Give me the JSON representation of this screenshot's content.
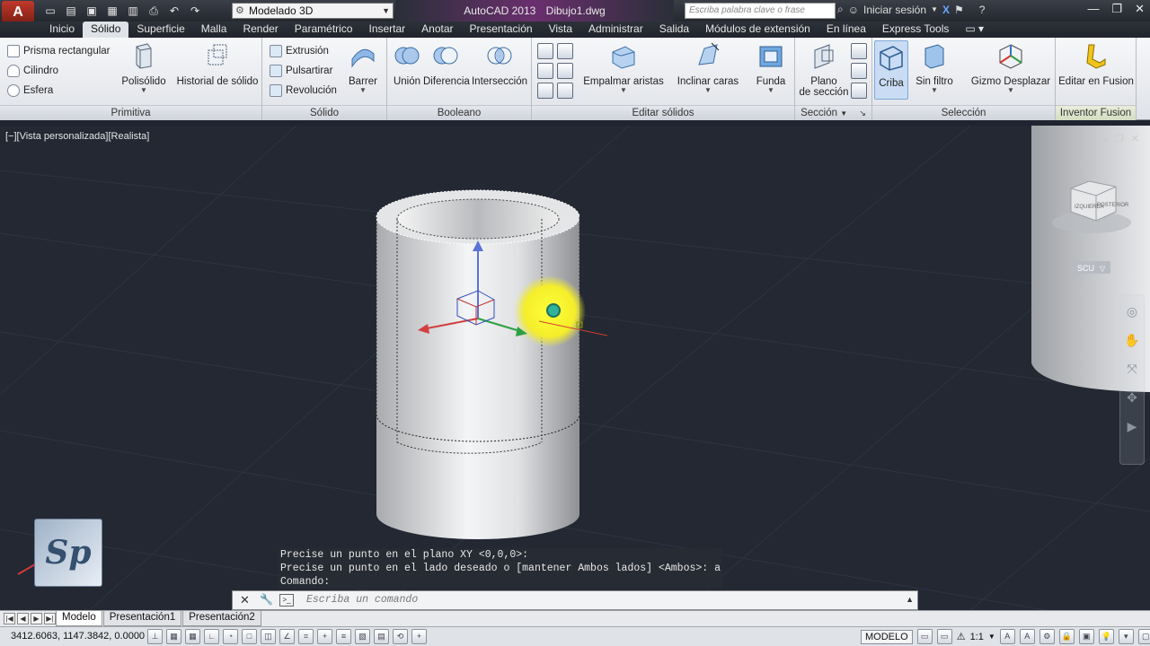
{
  "titlebar": {
    "app_button": "A",
    "workspace": "Modelado 3D",
    "app_name": "AutoCAD 2013",
    "document": "Dibujo1.dwg",
    "search_placeholder": "Escriba palabra clave o frase",
    "signin": "Iniciar sesión"
  },
  "tabs": [
    "Inicio",
    "Sólido",
    "Superficie",
    "Malla",
    "Render",
    "Paramétrico",
    "Insertar",
    "Anotar",
    "Presentación",
    "Vista",
    "Administrar",
    "Salida",
    "Módulos de extensión",
    "En línea",
    "Express Tools"
  ],
  "active_tab": "Sólido",
  "ribbon": {
    "primitiva": {
      "title": "Primitiva",
      "small": [
        "Prisma rectangular",
        "Cilindro",
        "Esfera"
      ],
      "polisolido": "Polisólido",
      "historial": "Historial de sólido"
    },
    "solido": {
      "title": "Sólido",
      "small": [
        "Extrusión",
        "Pulsartirar",
        "Revolución"
      ],
      "barrer": "Barrer"
    },
    "booleano": {
      "title": "Booleano",
      "union": "Unión",
      "diferencia": "Diferencia",
      "interseccion": "Intersección"
    },
    "editar": {
      "title": "Editar sólidos",
      "empalmar": "Empalmar aristas",
      "inclinar": "Inclinar caras",
      "funda": "Funda"
    },
    "seccion": {
      "title": "Sección",
      "plano_1": "Plano",
      "plano_2": "de sección"
    },
    "seleccion": {
      "title": "Selección",
      "criba": "Criba",
      "sin_filtro": "Sin filtro",
      "gizmo": "Gizmo Desplazar"
    },
    "inventor": {
      "title": "Inventor Fusion",
      "editar": "Editar en Fusion"
    }
  },
  "viewport": {
    "label": "[−][Vista personalizada][Realista]",
    "viewcube_face_1": "IZQUIERDA",
    "viewcube_face_2": "POSTERIOR",
    "ucs": "SCU",
    "logo": "Sp"
  },
  "command": {
    "history": [
      "Precise un punto en el plano XY <0,0,0>:",
      "Precise un punto en el lado deseado o [mantener Ambos lados] <Ambos>: a",
      "Comando:"
    ],
    "placeholder": "Escriba un comando"
  },
  "layout_tabs": [
    "Modelo",
    "Presentación1",
    "Presentación2"
  ],
  "status": {
    "coords": "3412.6063, 1147.3842, 0.0000",
    "space": "MODELO",
    "scale": "1:1"
  }
}
